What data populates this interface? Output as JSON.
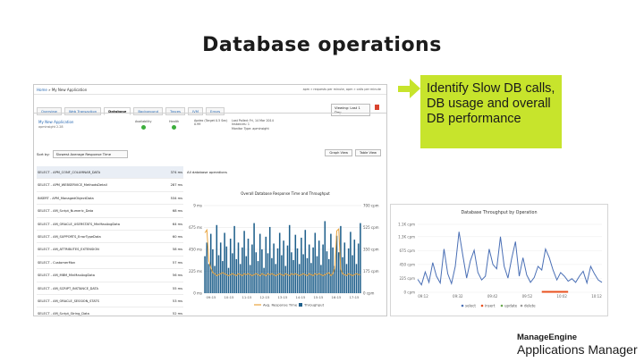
{
  "slide": {
    "title": "Database operations"
  },
  "app": {
    "breadcrumb_root": "Home",
    "breadcrumb_sep": "»",
    "breadcrumb_page": "My New Application",
    "header_meta": "apm » requests per minute, apm » calls per minute",
    "tabs": [
      {
        "label": "Overview",
        "active": false
      },
      {
        "label": "Web Transaction",
        "active": false
      },
      {
        "label": "Database",
        "active": true
      },
      {
        "label": "Background",
        "active": false
      },
      {
        "label": "Traces",
        "active": false
      },
      {
        "label": "JVM",
        "active": false
      },
      {
        "label": "Errors",
        "active": false
      }
    ],
    "view_label": "Viewing: Last 1 Day",
    "monitor": {
      "name": "My New Application",
      "subtitle": "apminsight 2.28",
      "availability_label": "Availability",
      "health_label": "Health",
      "info_line1": "Apdex (Target 0.5 Sec)",
      "info_line2": "0.99",
      "info_line3": "Last Polled: Fri, 14 Mar 2014",
      "info_line4": "Instances: 1",
      "info_line5": "Monitor Type: apminsight"
    },
    "sort_label": "Sort by:",
    "sort_value": "Slowest Average Response Time",
    "graph_view": "Graph View",
    "table_view": "Table View",
    "queries": [
      {
        "query": "SELECT - APM_CONF_COLUMNAR_DATA",
        "value": "374 ms",
        "selected": true
      },
      {
        "query": "SELECT - APM_WEBSERVICE_MethodsDetail",
        "value": "287 ms",
        "selected": false
      },
      {
        "query": "INSERT - APM_ManagedObjectData",
        "value": "534 ms",
        "selected": false
      },
      {
        "query": "SELECT - AM_Script_Numeric_Data",
        "value": "68 ms",
        "selected": false
      },
      {
        "query": "SELECT - AM_ORACLE_USERSTATS_MinMaxAvgData",
        "value": "64 ms",
        "selected": false
      },
      {
        "query": "SELECT - AM_SUPPORTS_ErrorTypeData",
        "value": "60 ms",
        "selected": false
      },
      {
        "query": "SELECT - AM_ATTRIBUTES_EXTENSION",
        "value": "58 ms",
        "selected": false
      },
      {
        "query": "SELECT - CustomerMon",
        "value": "57 ms",
        "selected": false
      },
      {
        "query": "SELECT - AM_MBM_MinMaxAvgData",
        "value": "56 ms",
        "selected": false
      },
      {
        "query": "SELECT - AM_SCRIPT_INSTANCE_DATA",
        "value": "55 ms",
        "selected": false
      },
      {
        "query": "SELECT - AM_ORACLE_SESSION_STATS",
        "value": "53 ms",
        "selected": false
      },
      {
        "query": "SELECT - AM_Script_String_Data",
        "value": "52 ms",
        "selected": false
      }
    ],
    "panel_header": "All database operations",
    "panel_chart_title": "Overall Database Response Time and Throughput",
    "panel_legend_1": "Avg. Response Time",
    "panel_legend_2": "Throughput"
  },
  "callout": {
    "text": "Identify Slow DB calls, DB usage and overall DB performance"
  },
  "colors": {
    "callout_bg": "#c7e42c",
    "bar": "#1f5f8b",
    "line_orange": "#e8a33d",
    "line_blue": "#4a6fb5",
    "line_red": "#e8501e",
    "link": "#2a6ab3"
  },
  "chart_data": [
    {
      "type": "bar",
      "title": "Overall Database Response Time and Throughput",
      "xlabel": "",
      "ylabel": "",
      "y_ticks_left": [
        "0 ms",
        "225 ms",
        "450 ms",
        "675 ms",
        "9 ms"
      ],
      "y_ticks_right": [
        "0 cpm",
        "175 cpm",
        "350 cpm",
        "525 cpm",
        "700 cpm"
      ],
      "x_ticks": [
        "09:15",
        "10:15",
        "11:15",
        "12:15",
        "13:15",
        "14:15",
        "15:15",
        "16:15",
        "17:15"
      ],
      "ylim": [
        0,
        900
      ],
      "series": [
        {
          "name": "Avg. Response Time",
          "kind": "bar",
          "values": [
            380,
            520,
            300,
            610,
            450,
            280,
            700,
            390,
            520,
            330,
            620,
            480,
            260,
            560,
            410,
            690,
            350,
            520,
            300,
            470,
            640,
            380,
            560,
            290,
            500,
            720,
            420,
            330,
            610,
            450,
            260,
            580,
            410,
            680,
            360,
            510,
            300,
            460,
            620,
            390,
            540,
            280,
            490,
            700,
            420,
            340,
            600,
            460,
            300,
            570,
            400,
            650,
            360,
            500,
            310,
            470,
            620,
            380,
            540,
            290,
            500,
            740,
            430,
            350,
            610,
            470,
            280,
            590,
            420,
            690,
            370,
            520,
            300,
            460,
            630,
            390,
            550,
            300,
            510,
            720
          ]
        },
        {
          "name": "Throughput",
          "kind": "line",
          "values": [
            620,
            650,
            330,
            260,
            210,
            200,
            180,
            190,
            200,
            210,
            200,
            190,
            180,
            190,
            200,
            190,
            180,
            200,
            190,
            180,
            200,
            190,
            200,
            190,
            180,
            190,
            200,
            190,
            180,
            200,
            190,
            180,
            200,
            190,
            200,
            190,
            180,
            190,
            200,
            190,
            180,
            200,
            190,
            180,
            200,
            190,
            200,
            190,
            180,
            190,
            200,
            190,
            180,
            200,
            190,
            180,
            200,
            190,
            200,
            190,
            180,
            190,
            200,
            210,
            180,
            200,
            260,
            640,
            660,
            250,
            200,
            190,
            180,
            200,
            190,
            180,
            190,
            200,
            190,
            190
          ]
        }
      ]
    },
    {
      "type": "line",
      "title": "Database Throughput by Operation",
      "xlabel": "",
      "ylabel": "",
      "y_ticks": [
        "0 cpm",
        "225 cpm",
        "450 cpm",
        "675 cpm",
        "1.3K cpm",
        "1.1K cpm"
      ],
      "x_ticks": [
        "09:12",
        "09:32",
        "09:42",
        "09:52",
        "10:02",
        "10:12"
      ],
      "ylim": [
        0,
        1100
      ],
      "legend": [
        "select",
        "insert",
        "update",
        "delete"
      ],
      "series": [
        {
          "name": "select",
          "values": [
            210,
            120,
            330,
            160,
            480,
            260,
            150,
            700,
            300,
            140,
            420,
            980,
            600,
            230,
            510,
            680,
            320,
            200,
            260,
            700,
            450,
            380,
            900,
            420,
            230,
            550,
            820,
            260,
            560,
            280,
            160,
            240,
            420,
            360,
            700,
            560,
            360,
            200,
            320,
            260,
            180,
            220,
            160,
            260,
            340,
            150,
            420,
            300,
            200,
            160
          ]
        },
        {
          "name": "insert",
          "values": []
        },
        {
          "name": "update",
          "values": []
        },
        {
          "name": "delete",
          "values": []
        }
      ]
    }
  ],
  "brand": {
    "line1": "ManageEngine",
    "line2": "Applications Manager"
  }
}
